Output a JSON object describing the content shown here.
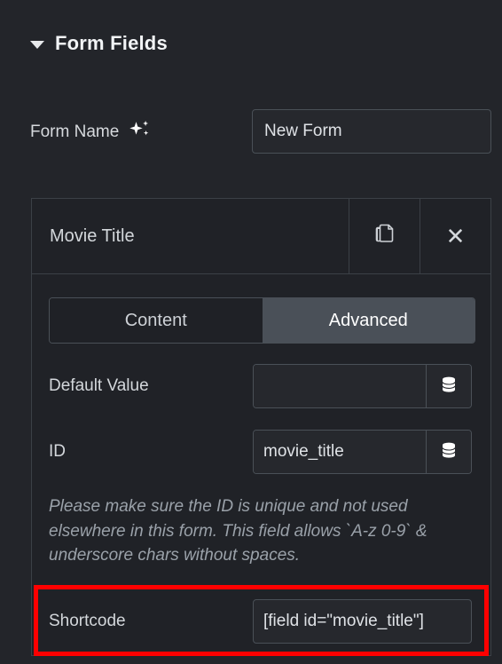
{
  "section": {
    "title": "Form Fields",
    "caret_icon": "chevron-down-icon",
    "expanded": true
  },
  "form_name": {
    "label": "Form Name",
    "ai_icon": "sparkle-icon",
    "value": "New Form",
    "placeholder": "Form Name"
  },
  "field": {
    "title": "Movie Title",
    "duplicate_icon": "duplicate-icon",
    "close_icon": "close-icon",
    "tabs": [
      {
        "label": "Content",
        "active": false
      },
      {
        "label": "Advanced",
        "active": true
      }
    ],
    "default_value": {
      "label": "Default Value",
      "value": "",
      "placeholder": "",
      "dynamic_icon": "database-icon"
    },
    "id": {
      "label": "ID",
      "value": "movie_title",
      "placeholder": "",
      "dynamic_icon": "database-icon"
    },
    "help_text": "Please make sure the ID is unique and not used elsewhere in this form. This field allows `A-z 0-9` & underscore chars without spaces.",
    "shortcode": {
      "label": "Shortcode",
      "value": "[field id=\"movie_title\"]"
    }
  },
  "annotation": {
    "highlight_color": "#ff0000",
    "highlight_target": "shortcode-row"
  },
  "theme": {
    "page_bg": "#23252a",
    "card_bg": "#202227",
    "input_bg": "#26282d",
    "border": "#4a5057",
    "text": "#d3d7db",
    "active_tab_bg": "#4a5058"
  }
}
